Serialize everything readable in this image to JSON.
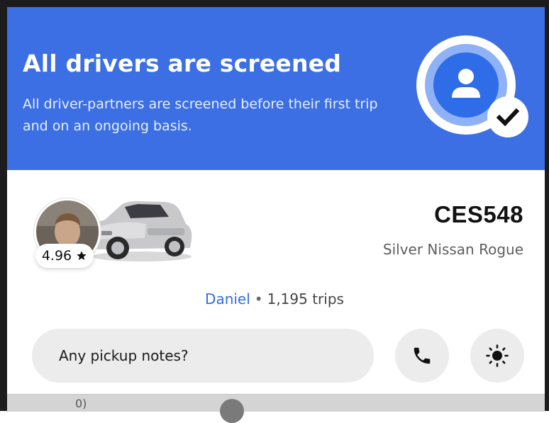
{
  "banner": {
    "title": "All drivers are screened",
    "subtitle": "All driver-partners are screened before their first trip and on an ongoing basis.",
    "icon": "verified-user-icon",
    "color": "#3b6fe3"
  },
  "trip": {
    "rating": "4.96",
    "rating_icon": "star-icon",
    "plate": "CES548",
    "vehicle": "Silver Nissan Rogue",
    "driver_name": "Daniel",
    "separator": "•",
    "trips": "1,195 trips"
  },
  "actions": {
    "notes_placeholder": "Any pickup notes?",
    "call_icon": "phone-icon",
    "brightness_icon": "brightness-icon"
  },
  "bottom": {
    "partial_text": "0)"
  }
}
